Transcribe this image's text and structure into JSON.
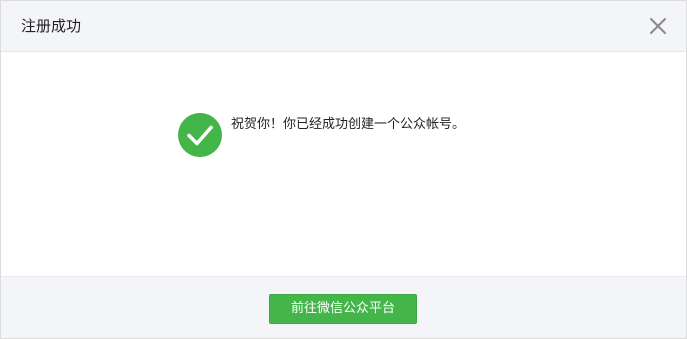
{
  "dialog": {
    "title": "注册成功",
    "close_icon": "close-icon"
  },
  "body": {
    "icon": "check-circle-icon",
    "message": "祝贺你！你已经成功创建一个公众帐号。"
  },
  "footer": {
    "button_label": "前往微信公众平台"
  },
  "colors": {
    "accent": "#44b549",
    "header_bg": "#f4f5f9",
    "footer_bg": "#f4f5f9",
    "text": "#222222",
    "close_icon": "#8a8a8a"
  }
}
